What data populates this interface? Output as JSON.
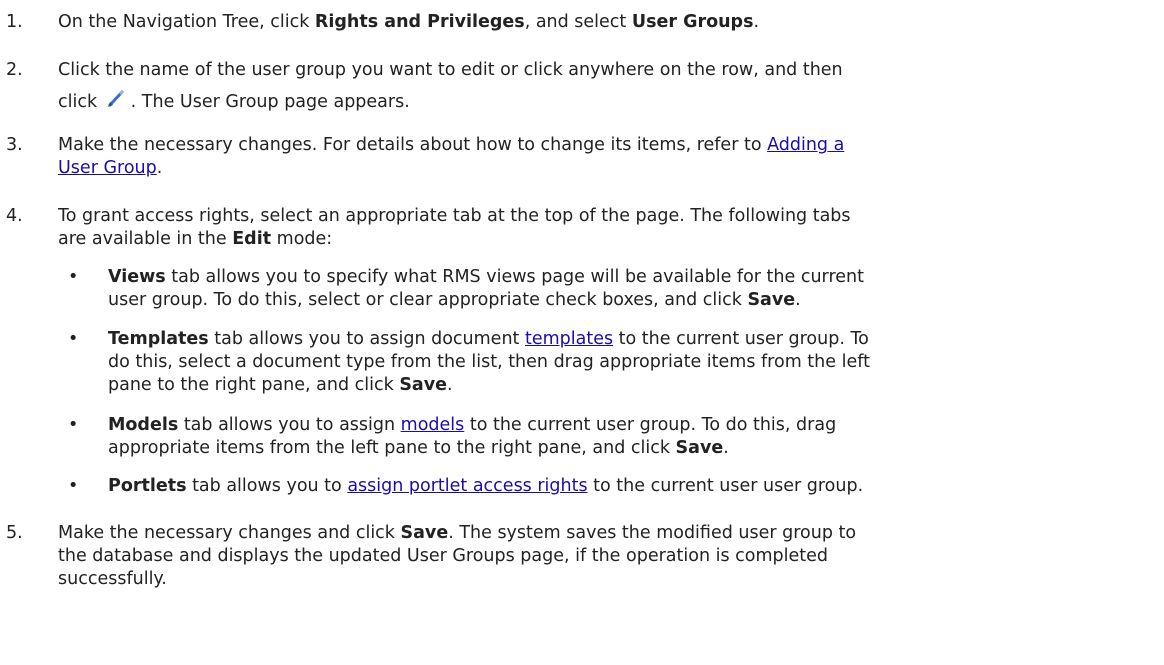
{
  "steps": [
    {
      "num": "1.",
      "parts": [
        "On the Navigation Tree, click ",
        "Rights and Privileges",
        ", and select ",
        "User Groups",
        "."
      ]
    },
    {
      "num": "2.",
      "line1": "Click the name of the user group you want to edit or click anywhere on the row, and then",
      "line2a": "click ",
      "line2b": ". The User Group page appears."
    },
    {
      "num": "3.",
      "a": "Make the necessary changes. For details about how to change its items, refer to ",
      "link1": "Adding a",
      "link2": "User Group",
      "end": "."
    },
    {
      "num": "4.",
      "line1": "To grant access rights, select an appropriate tab at the top of the page. The following tabs",
      "line2a": "are available in the ",
      "line2b": "Edit",
      "line2c": " mode:"
    },
    {
      "num": "5.",
      "a": "Make the necessary changes and click ",
      "b": "Save",
      "c": ". The system saves the modified user group to",
      "line2": "the database and displays the updated User Groups page, if the operation is completed",
      "line3": "successfully."
    }
  ],
  "bullets": [
    {
      "dot": "•",
      "name": "Views",
      "l1": " tab allows you to specify what RMS views page will be available for the current",
      "l2a": "user group. To do this, select or clear appropriate check boxes, and click ",
      "l2b": "Save",
      "l2c": "."
    },
    {
      "dot": "•",
      "name": "Templates",
      "l1a": " tab allows you to assign document ",
      "link": "templates",
      "l1b": " to the current user group. To",
      "l2": "do this, select a document type from the list, then drag appropriate items from the left",
      "l3a": "pane to the right pane, and click ",
      "l3b": "Save",
      "l3c": "."
    },
    {
      "dot": "•",
      "name": "Models",
      "l1a": " tab allows you to assign ",
      "link": "models",
      "l1b": " to the current user group. To do this, drag",
      "l2a": "appropriate items from the left pane to the right pane, and click ",
      "l2b": "Save",
      "l2c": "."
    },
    {
      "dot": "•",
      "name": "Portlets",
      "l1a": " tab allows you to ",
      "link": "assign portlet access rights",
      "l1b": " to the current user user group."
    }
  ],
  "icons": {
    "edit": "pencil-edit-icon"
  }
}
